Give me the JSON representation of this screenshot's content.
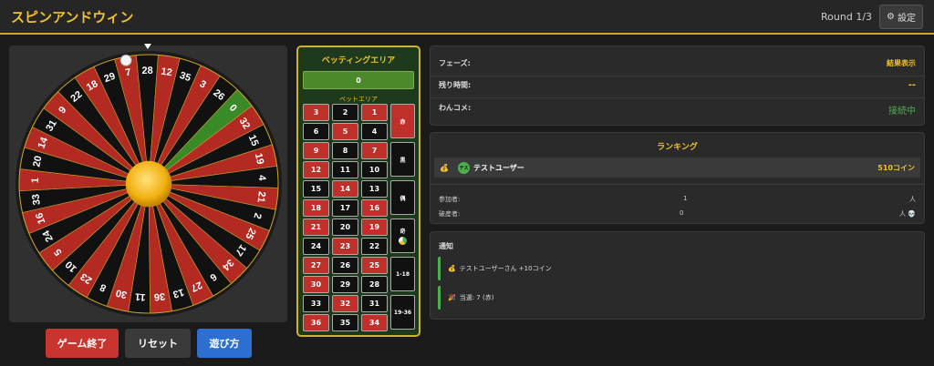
{
  "header": {
    "title": "スピンアンドウィン",
    "round": "Round 1/3",
    "settings_icon": "⚙",
    "settings_label": "設定"
  },
  "wheel": {
    "numbers": [
      "0",
      "32",
      "15",
      "19",
      "4",
      "21",
      "2",
      "25",
      "17",
      "34",
      "6",
      "27",
      "13",
      "36",
      "11",
      "30",
      "8",
      "23",
      "10",
      "5",
      "24",
      "16",
      "33",
      "1",
      "20",
      "14",
      "31",
      "9",
      "22",
      "18",
      "29",
      "7",
      "28",
      "12",
      "35",
      "3",
      "26"
    ],
    "colors": {
      "red": "#b22a22",
      "black": "#111111",
      "green": "#3a8a2a",
      "rim": "#1b1b1b",
      "gold": "#c9a22a"
    }
  },
  "controls": {
    "end_label": "ゲーム終了",
    "reset_label": "リセット",
    "help_label": "遊び方"
  },
  "betting": {
    "title": "ベッティングエリア",
    "amount": "0",
    "sub_title": "ベットエリア",
    "rows": [
      [
        {
          "n": "3",
          "c": "red"
        },
        {
          "n": "2",
          "c": "black"
        },
        {
          "n": "1",
          "c": "red"
        }
      ],
      [
        {
          "n": "6",
          "c": "black"
        },
        {
          "n": "5",
          "c": "red"
        },
        {
          "n": "4",
          "c": "black"
        }
      ],
      [
        {
          "n": "9",
          "c": "red"
        },
        {
          "n": "8",
          "c": "black"
        },
        {
          "n": "7",
          "c": "red"
        }
      ],
      [
        {
          "n": "12",
          "c": "red"
        },
        {
          "n": "11",
          "c": "black"
        },
        {
          "n": "10",
          "c": "black"
        }
      ],
      [
        {
          "n": "15",
          "c": "black"
        },
        {
          "n": "14",
          "c": "red"
        },
        {
          "n": "13",
          "c": "black"
        }
      ],
      [
        {
          "n": "18",
          "c": "red"
        },
        {
          "n": "17",
          "c": "black"
        },
        {
          "n": "16",
          "c": "red"
        }
      ],
      [
        {
          "n": "21",
          "c": "red"
        },
        {
          "n": "20",
          "c": "black"
        },
        {
          "n": "19",
          "c": "red"
        }
      ],
      [
        {
          "n": "24",
          "c": "black"
        },
        {
          "n": "23",
          "c": "red"
        },
        {
          "n": "22",
          "c": "black"
        }
      ],
      [
        {
          "n": "27",
          "c": "red"
        },
        {
          "n": "26",
          "c": "black"
        },
        {
          "n": "25",
          "c": "red"
        }
      ],
      [
        {
          "n": "30",
          "c": "red"
        },
        {
          "n": "29",
          "c": "black"
        },
        {
          "n": "28",
          "c": "black"
        }
      ],
      [
        {
          "n": "33",
          "c": "black"
        },
        {
          "n": "32",
          "c": "red"
        },
        {
          "n": "31",
          "c": "black"
        }
      ],
      [
        {
          "n": "36",
          "c": "red"
        },
        {
          "n": "35",
          "c": "black"
        },
        {
          "n": "34",
          "c": "red"
        }
      ]
    ],
    "side": {
      "red": "赤",
      "black": "黒",
      "even": "偶",
      "odd": "奇",
      "low": "1-18",
      "high": "19-36"
    }
  },
  "status": {
    "phase_label": "フェーズ:",
    "phase_value": "結果表示",
    "time_label": "残り時間:",
    "time_value": "--",
    "comment_label": "わんコメ:",
    "comment_value": "接続中"
  },
  "ranking": {
    "title": "ランキング",
    "entries": [
      {
        "medal": "💰",
        "avatar": "テス",
        "name": "テストユーザー",
        "coins": "510コイン"
      }
    ],
    "participants_label": "参加者:",
    "participants_value": "1",
    "participants_unit": "人",
    "bankrupt_label": "破産者:",
    "bankrupt_value": "0",
    "bankrupt_unit": "人 💀"
  },
  "notifications": {
    "title": "通知",
    "items": [
      {
        "icon": "💰",
        "text": "テストユーザーさん +10コイン"
      },
      {
        "icon": "🎉",
        "text": "当選: 7 (赤)"
      }
    ]
  }
}
